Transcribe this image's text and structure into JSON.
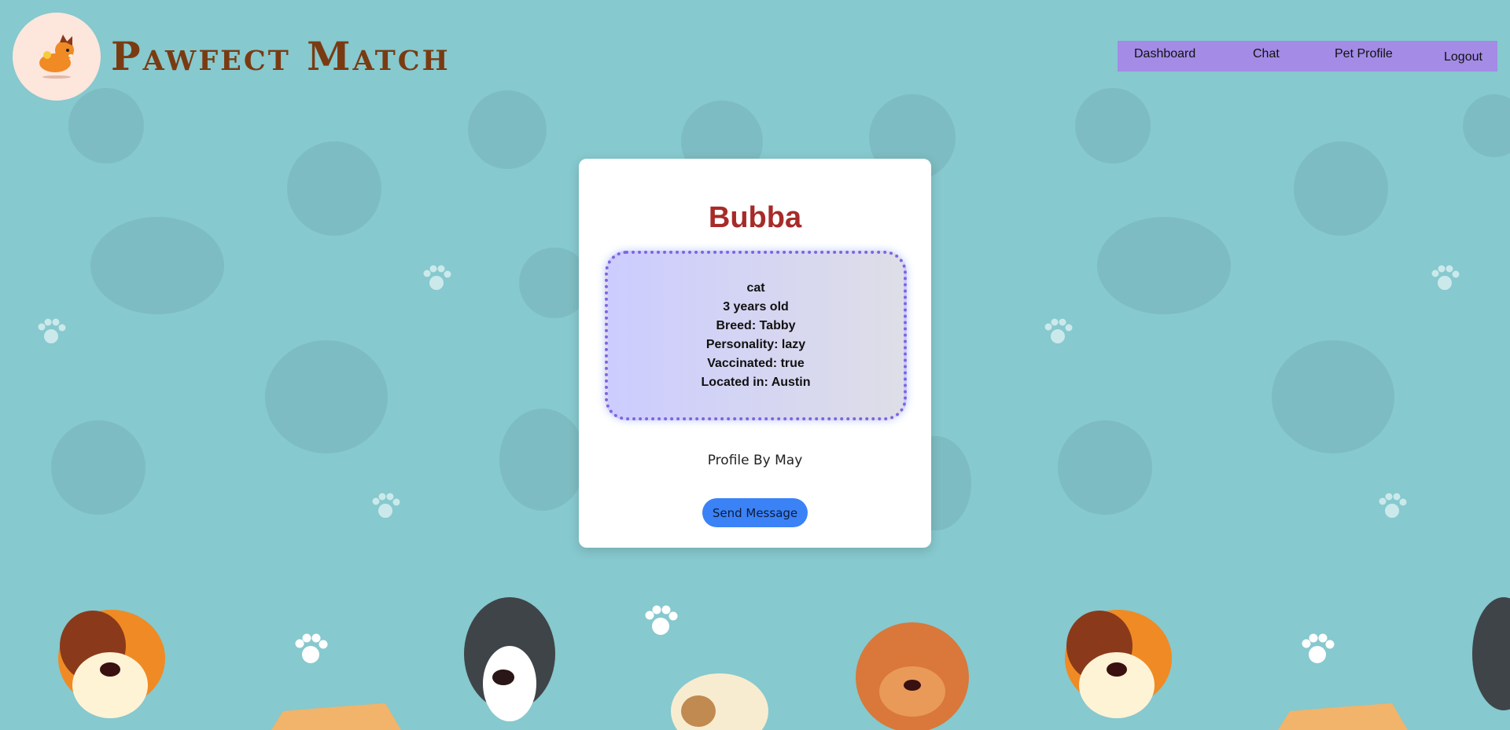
{
  "header": {
    "brand": "Pawfect Match",
    "logo_icon": "dog-mascot-icon"
  },
  "nav": {
    "items": [
      {
        "label": "Dashboard"
      },
      {
        "label": "Chat"
      },
      {
        "label": "Pet Profile"
      },
      {
        "label": "Logout"
      }
    ]
  },
  "profile": {
    "name": "Bubba",
    "type": "cat",
    "age": "3 years old",
    "breed": "Breed: Tabby",
    "personality": "Personality: lazy",
    "vaccinated": "Vaccinated: true",
    "location": "Located in: Austin",
    "owner": "Profile By May",
    "send_label": "Send Message"
  },
  "colors": {
    "background": "#86c9ce",
    "nav": "#a38be6",
    "name": "#a72b29",
    "button": "#3b82f6",
    "brand": "#7a3b12"
  }
}
